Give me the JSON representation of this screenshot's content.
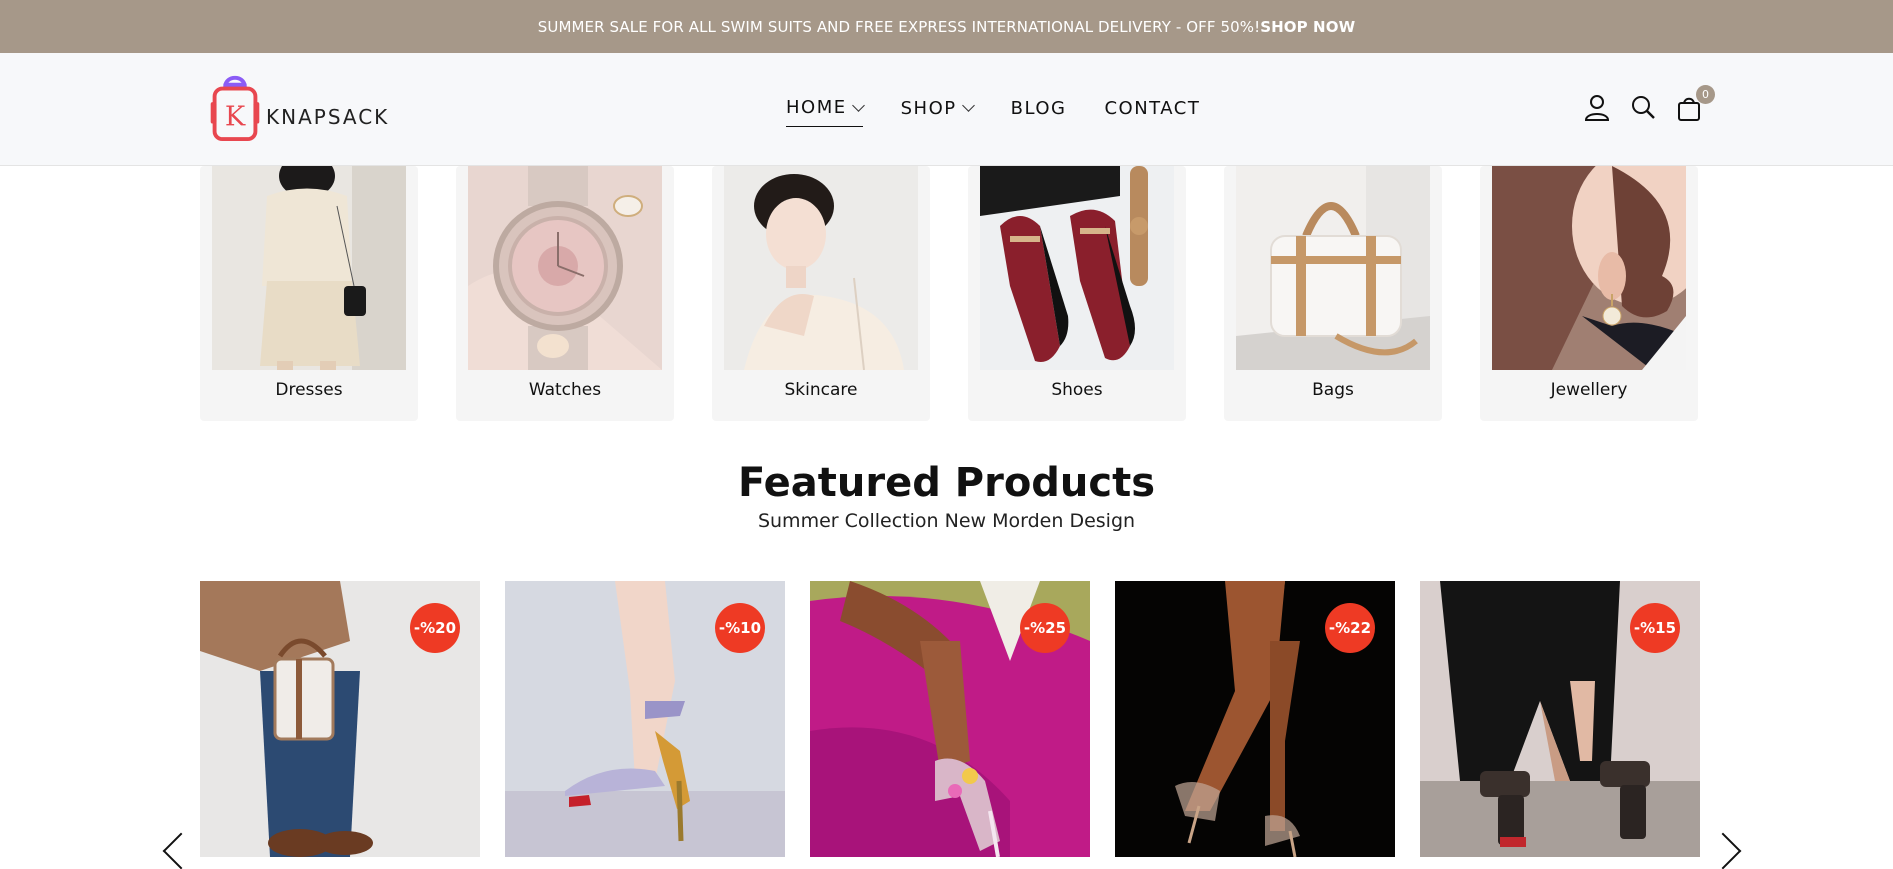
{
  "announcement": {
    "text": "SUMMER SALE FOR ALL SWIM SUITS AND FREE EXPRESS INTERNATIONAL DELIVERY - OFF 50%!",
    "cta": "SHOP NOW"
  },
  "brand": {
    "letter": "K",
    "name": "KNAPSACK",
    "accent": "#e8474f",
    "handle": "#8b5cf6"
  },
  "nav": {
    "home": "HOME",
    "shop": "SHOP",
    "blog": "BLOG",
    "contact": "CONTACT"
  },
  "header_icons": {
    "account": "user-icon",
    "search": "search-icon",
    "cart": "cart-icon",
    "cart_count": "0"
  },
  "categories": [
    {
      "label": "Dresses"
    },
    {
      "label": "Watches"
    },
    {
      "label": "Skincare"
    },
    {
      "label": "Shoes"
    },
    {
      "label": "Bags"
    },
    {
      "label": "Jewellery"
    }
  ],
  "featured": {
    "title": "Featured Products",
    "subtitle": "Summer Collection New Morden Design"
  },
  "products": [
    {
      "discount": "-%20"
    },
    {
      "discount": "-%10"
    },
    {
      "discount": "-%25"
    },
    {
      "discount": "-%22"
    },
    {
      "discount": "-%15"
    }
  ],
  "colors": {
    "topbar": "#a69889",
    "discount_badge": "#ee3a24",
    "header_bg": "#f7f8fa"
  }
}
